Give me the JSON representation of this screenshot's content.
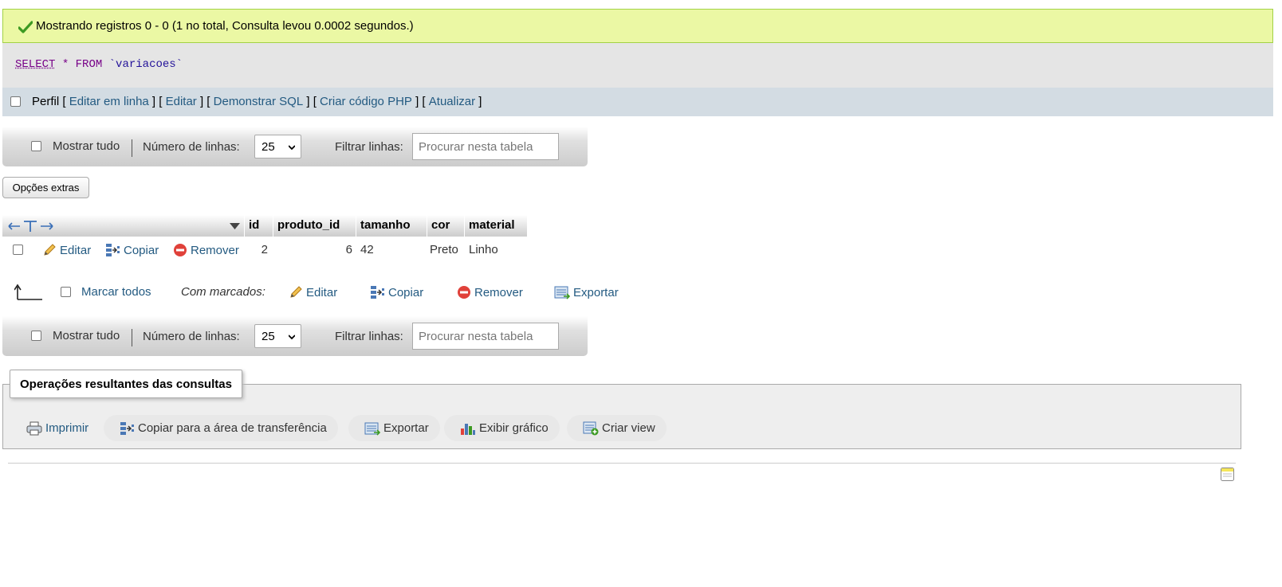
{
  "success": {
    "message": "Mostrando registros 0 - 0 (1 no total, Consulta levou 0.0002 segundos.)"
  },
  "sql": {
    "select": "SELECT",
    "star": "*",
    "from": "FROM",
    "table": "`variacoes`"
  },
  "profile_bar": {
    "perfil": "Perfil",
    "links": [
      "Editar em linha",
      "Editar",
      "Demonstrar SQL",
      "Criar código PHP",
      "Atualizar"
    ]
  },
  "nav": {
    "show_all": "Mostrar tudo",
    "rows_label": "Número de linhas:",
    "rows_value": "25",
    "filter_label": "Filtrar linhas:",
    "filter_placeholder": "Procurar nesta tabela"
  },
  "extra_options": "Opções extras",
  "table": {
    "headers": [
      "id",
      "produto_id",
      "tamanho",
      "cor",
      "material"
    ],
    "row_actions": {
      "edit": "Editar",
      "copy": "Copiar",
      "delete": "Remover"
    },
    "rows": [
      {
        "id": "2",
        "produto_id": "6",
        "tamanho": "42",
        "cor": "Preto",
        "material": "Linho"
      }
    ]
  },
  "with_selected": {
    "check_all": "Marcar todos",
    "label": "Com marcados:",
    "edit": "Editar",
    "copy": "Copiar",
    "delete": "Remover",
    "export": "Exportar"
  },
  "query_ops": {
    "legend": "Operações resultantes das consultas",
    "print": "Imprimir",
    "copy_clipboard": "Copiar para a área de transferência",
    "export": "Exportar",
    "chart": "Exibir gráfico",
    "create_view": "Criar view"
  },
  "colors": {
    "success_bg": "#ebf8a4",
    "link": "#235a81",
    "delete_red": "#e0413a"
  }
}
